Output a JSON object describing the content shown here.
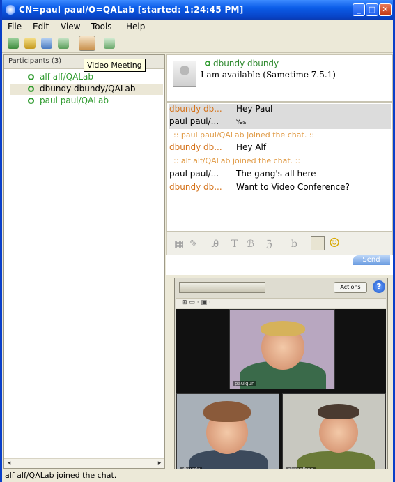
{
  "window": {
    "title": "CN=paul paul/O=QALab [started: 1:24:45 PM]",
    "accent": "#0a3fc8"
  },
  "menu": [
    "File",
    "Edit",
    "View",
    "Tools",
    "Help"
  ],
  "toolbar": {
    "icons": [
      "invite-icon",
      "chat-icon",
      "screen-share-icon",
      "call-icon",
      "video-meeting-icon",
      "pass-control-icon"
    ],
    "tooltip": "Video Meeting"
  },
  "participants": {
    "header": "Participants (3)",
    "items": [
      {
        "label": "alf alf/QALab",
        "color": "#2f9b2f"
      },
      {
        "label": "dbundy dbundy/QALab",
        "color": "#000000"
      },
      {
        "label": "paul paul/QALab",
        "color": "#2f9b2f"
      }
    ]
  },
  "presence": {
    "name": "dbundy dbundy",
    "status": "I am available  (Sametime 7.5.1)"
  },
  "transcript": [
    {
      "who": "dbundy db...",
      "text": "Hey Paul",
      "type": "msg",
      "who_color": "orange"
    },
    {
      "who": "paul paul/...",
      "text": "Yes",
      "type": "msg",
      "who_color": "black"
    },
    {
      "who": "",
      "text": ":: paul paul/QALab joined the chat. ::",
      "type": "sys"
    },
    {
      "who": "dbundy db...",
      "text": "Hey Alf",
      "type": "msg",
      "who_color": "orange"
    },
    {
      "who": "",
      "text": ":: alf alf/QALab joined the chat. ::",
      "type": "sys"
    },
    {
      "who": "paul paul/...",
      "text": "The gang's all here",
      "type": "msg",
      "who_color": "black"
    },
    {
      "who": "dbundy db...",
      "text": "Want to Video Conference?",
      "type": "msg",
      "who_color": "orange"
    }
  ],
  "compose": {
    "send_label": "Send"
  },
  "video": {
    "actions_label": "Actions",
    "help_label": "?",
    "tiles": [
      {
        "label": "paulgun"
      },
      {
        "label": "dbundy"
      },
      {
        "label": "alfconfbng"
      }
    ]
  },
  "statusbar": {
    "text": "alf alf/QALab joined the chat."
  }
}
